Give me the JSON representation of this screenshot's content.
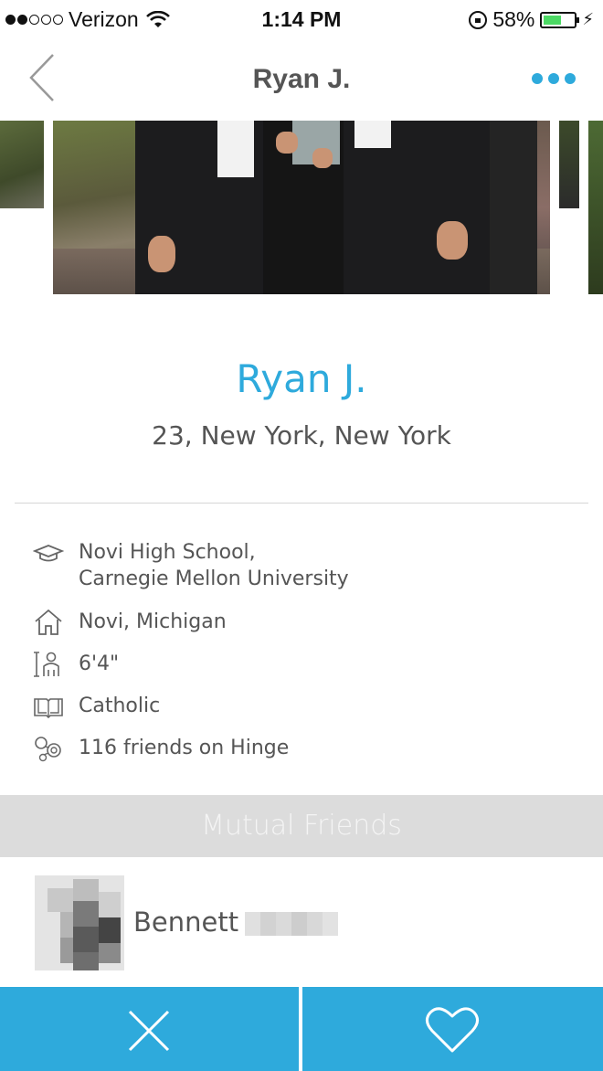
{
  "status_bar": {
    "carrier": "Verizon",
    "time": "1:14 PM",
    "battery_percent": "58%",
    "battery_level": 0.58,
    "signal_bars": 2,
    "signal_total": 5
  },
  "nav": {
    "title": "Ryan J.",
    "back_icon": "chevron-left-icon",
    "more_icon": "ellipsis-icon"
  },
  "profile": {
    "name": "Ryan J.",
    "subtitle": "23, New York, New York"
  },
  "details": [
    {
      "icon": "graduation-cap-icon",
      "lines": [
        "Novi High School,",
        "Carnegie Mellon University"
      ]
    },
    {
      "icon": "home-icon",
      "lines": [
        "Novi, Michigan"
      ]
    },
    {
      "icon": "height-icon",
      "lines": [
        "6'4\""
      ]
    },
    {
      "icon": "book-icon",
      "lines": [
        "Catholic"
      ]
    },
    {
      "icon": "friends-network-icon",
      "lines": [
        "116 friends on Hinge"
      ]
    }
  ],
  "mutual_friends": {
    "header": "Mutual Friends",
    "friends": [
      {
        "first_name": "Bennett"
      }
    ]
  },
  "actions": {
    "pass_icon": "close-icon",
    "like_icon": "heart-icon"
  },
  "colors": {
    "accent": "#2eaadc",
    "header_gray": "#dcdcdc",
    "text_gray": "#555555"
  }
}
